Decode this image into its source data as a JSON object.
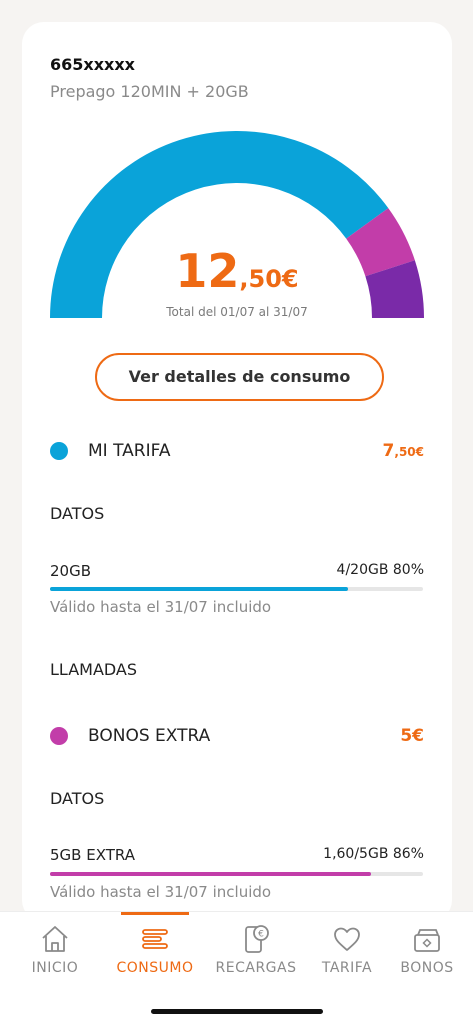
{
  "line": {
    "number": "665xxxxx",
    "plan": "Prepago 120MIN + 20GB"
  },
  "summary": {
    "amount_int": "12",
    "amount_dec": ",50€",
    "range": "Total del 01/07 al 31/07",
    "details_button": "Ver detalles de consumo"
  },
  "gauge": {
    "segments": [
      {
        "name": "MI TARIFA",
        "fraction": 0.8,
        "color": "#0aa3d9"
      },
      {
        "name": "BONOS EXTRA magenta",
        "fraction": 0.1,
        "color": "#c23da9"
      },
      {
        "name": "BONOS EXTRA purple",
        "fraction": 0.1,
        "color": "#7a2aa8"
      }
    ]
  },
  "sections": {
    "tarifa": {
      "label": "MI TARIFA",
      "amount_int": "7",
      "amount_dec": ",50€",
      "color": "#0aa3d9",
      "datos_title": "DATOS",
      "usage_name": "20GB",
      "usage_value": "4/20GB 80%",
      "usage_fraction": 0.8,
      "validity": "Válido hasta el 31/07 incluido",
      "llamadas_title": "LLAMADAS"
    },
    "bonos": {
      "label": "BONOS EXTRA",
      "amount": "5€",
      "color": "#c23da9",
      "datos_title": "DATOS",
      "usage_name": "5GB EXTRA",
      "usage_value": "1,60/5GB 86%",
      "usage_fraction": 0.86,
      "validity": "Válido hasta el 31/07 incluido"
    }
  },
  "tabbar": {
    "tabs": [
      {
        "label": "INICIO",
        "icon": "home-icon"
      },
      {
        "label": "CONSUMO",
        "icon": "consumption-icon",
        "active": true
      },
      {
        "label": "RECARGAS",
        "icon": "phone-euro-icon"
      },
      {
        "label": "TARIFA",
        "icon": "heart-icon"
      },
      {
        "label": "BONOS",
        "icon": "wallet-icon"
      }
    ]
  },
  "colors": {
    "accent": "#ee6a14",
    "tarifa": "#0aa3d9",
    "bonos": "#c23da9",
    "bonos_secondary": "#7a2aa8"
  }
}
